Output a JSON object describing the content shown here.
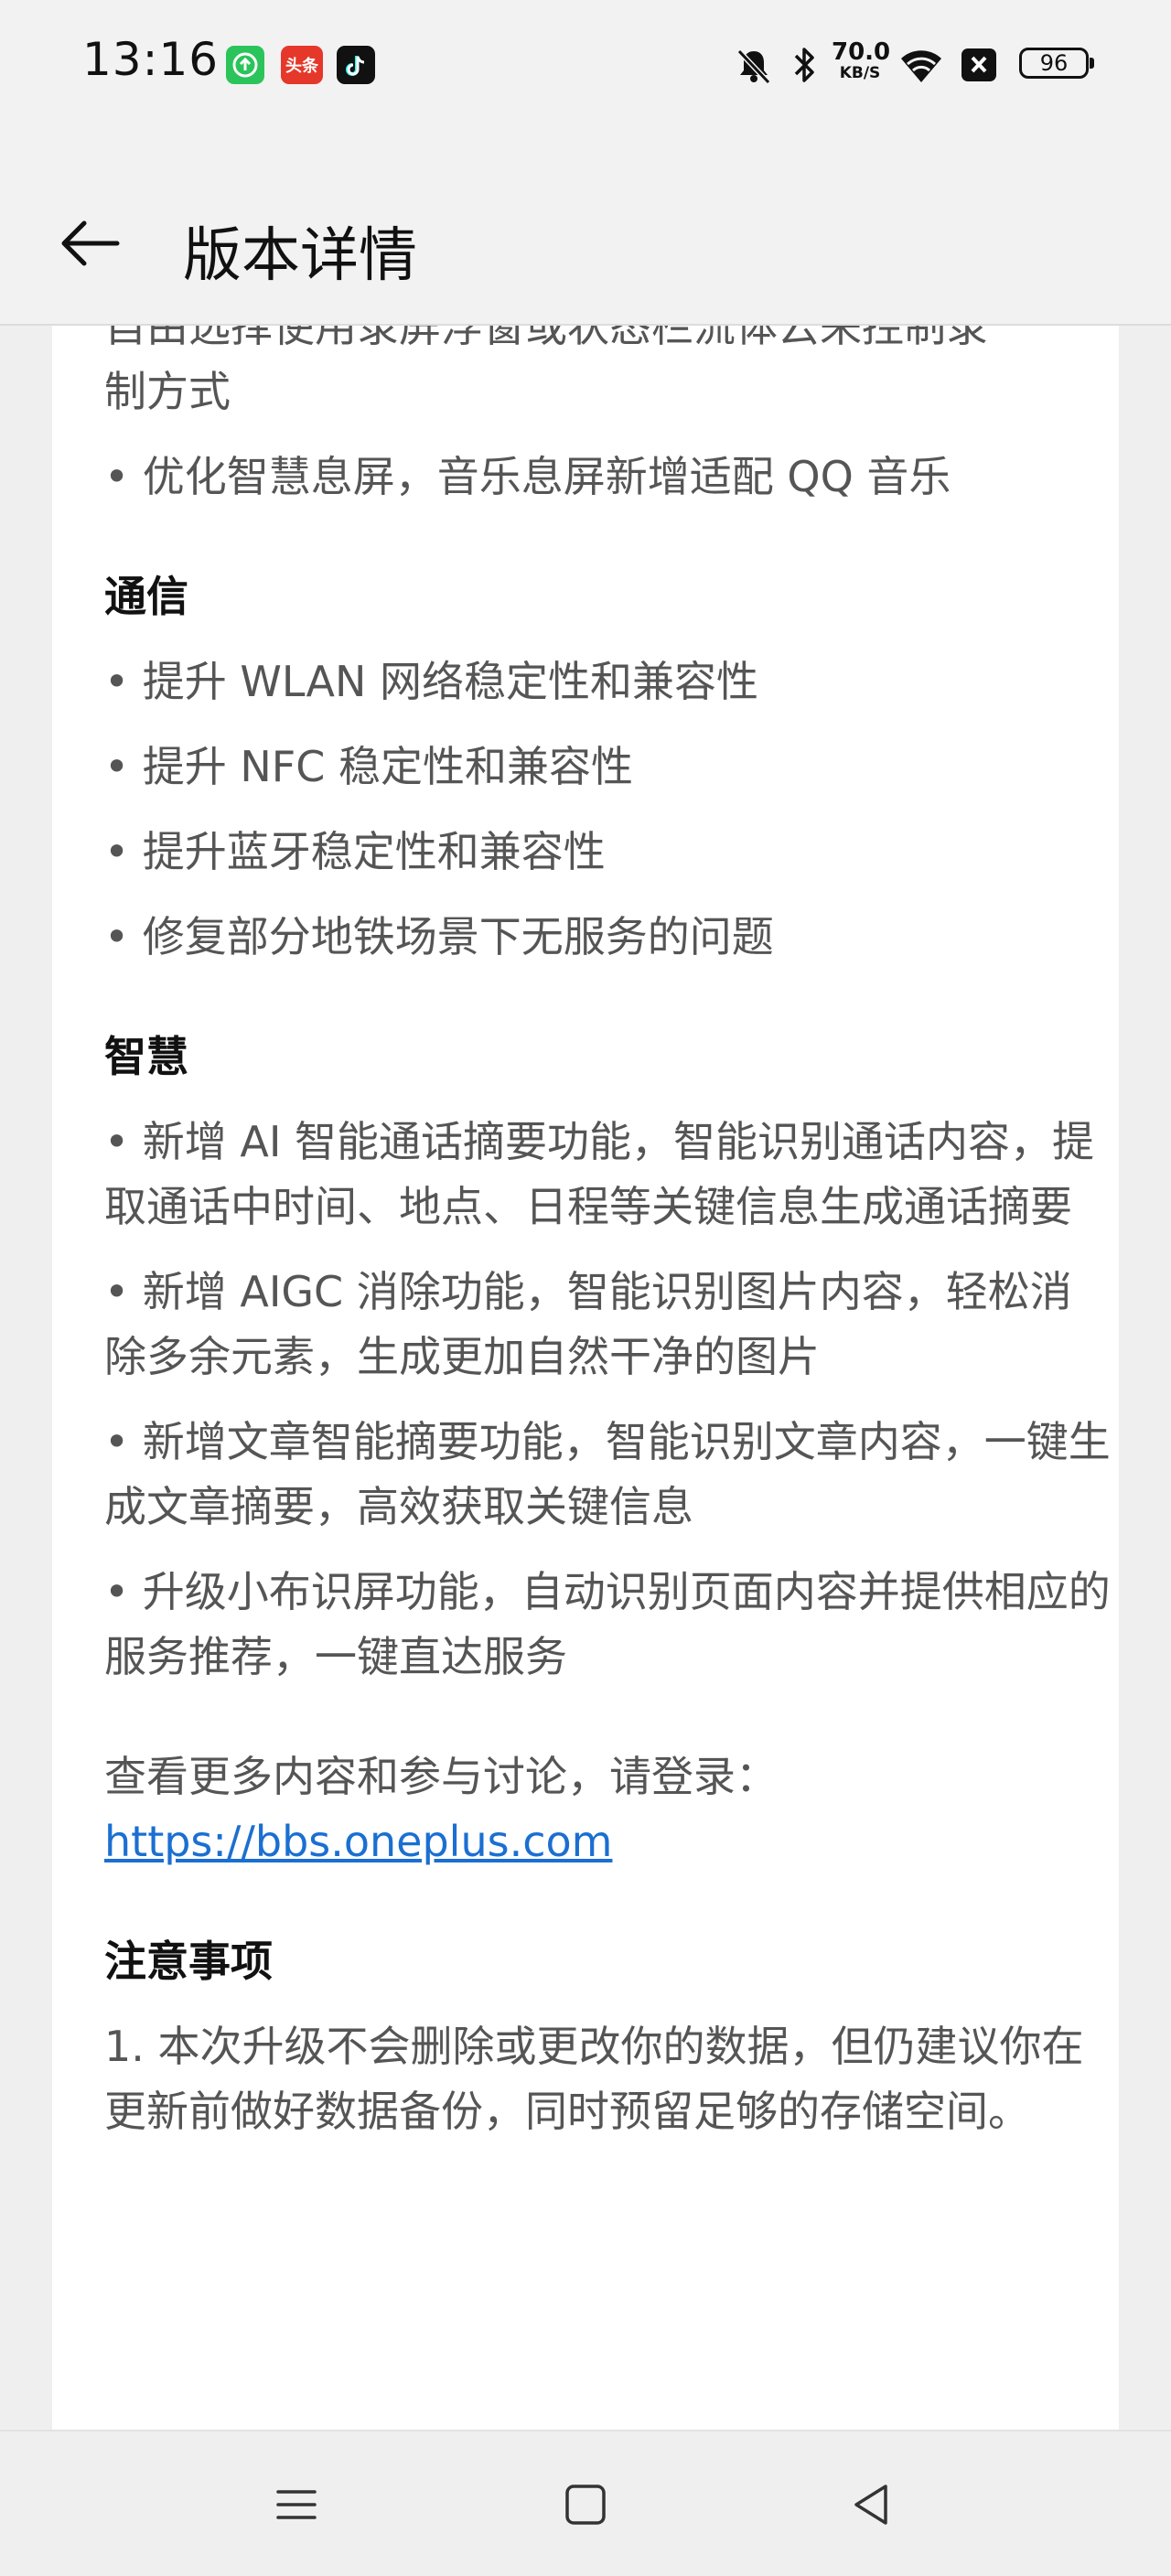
{
  "status_bar": {
    "time": "13:16",
    "app_icons": [
      "green-app-icon",
      "toutiao-icon",
      "tiktok-icon"
    ],
    "toutiao_label": "头条",
    "net_speed_value": "70.0",
    "net_speed_unit": "KB/S",
    "battery": "96"
  },
  "app_bar": {
    "title": "版本详情"
  },
  "content": {
    "intro_line_1": "自由选择使用录屏浮窗或状态栏流体云来控制录",
    "intro_line_2": "制方式",
    "intro_item": "• 优化智慧息屏，音乐息屏新增适配 QQ 音乐",
    "sections": [
      {
        "title": "通信",
        "items": [
          "• 提升 WLAN 网络稳定性和兼容性",
          "• 提升 NFC 稳定性和兼容性",
          "• 提升蓝牙稳定性和兼容性",
          "• 修复部分地铁场景下无服务的问题"
        ]
      },
      {
        "title": "智慧",
        "items": [
          "• 新增 AI 智能通话摘要功能，智能识别通话内容，提取通话中时间、地点、日程等关键信息生成通话摘要",
          "• 新增 AIGC 消除功能，智能识别图片内容，轻松消除多余元素，生成更加自然干净的图片",
          "• 新增文章智能摘要功能，智能识别文章内容，一键生成文章摘要，高效获取关键信息",
          "• 升级小布识屏功能，自动识别页面内容并提供相应的服务推荐，一键直达服务"
        ]
      }
    ],
    "more_text": "查看更多内容和参与讨论，请登录：",
    "more_link": "https://bbs.oneplus.com",
    "notice_title": "注意事项",
    "notice_item_1": "1. 本次升级不会删除或更改你的数据，但仍建议你在更新前做好数据备份，同时预留足够的存储空间。"
  },
  "nav_bar": {
    "icons": [
      "menu-icon",
      "home-icon",
      "back-triangle-icon"
    ]
  },
  "colors": {
    "link": "#1b6fd1",
    "body_text": "#555555",
    "heading_text": "#111111",
    "background": "#efeff0",
    "card": "#ffffff"
  }
}
